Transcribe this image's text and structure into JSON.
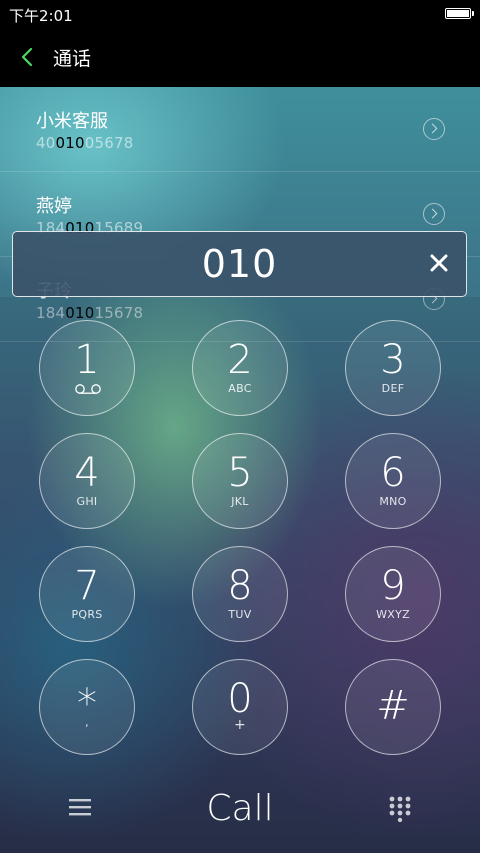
{
  "status_bar": {
    "time": "下午2:01"
  },
  "header": {
    "title": "通话"
  },
  "contacts": [
    {
      "name": "小米客服",
      "number_pre": "40",
      "number_match": "010",
      "number_post": "05678"
    },
    {
      "name": "燕婷",
      "number_pre": "184",
      "number_match": "010",
      "number_post": "15689"
    },
    {
      "name": "子玲",
      "number_pre": "184",
      "number_match": "010",
      "number_post": "15678"
    }
  ],
  "dial": {
    "number": "010"
  },
  "keypad": [
    {
      "digit": "1",
      "letters": ""
    },
    {
      "digit": "2",
      "letters": "ABC"
    },
    {
      "digit": "3",
      "letters": "DEF"
    },
    {
      "digit": "4",
      "letters": "GHI"
    },
    {
      "digit": "5",
      "letters": "JKL"
    },
    {
      "digit": "6",
      "letters": "MNO"
    },
    {
      "digit": "7",
      "letters": "PQRS"
    },
    {
      "digit": "8",
      "letters": "TUV"
    },
    {
      "digit": "9",
      "letters": "WXYZ"
    },
    {
      "digit": "*",
      "letters": ","
    },
    {
      "digit": "0",
      "letters": "+"
    },
    {
      "digit": "#",
      "letters": ""
    }
  ],
  "bottom_bar": {
    "call_label": "Call"
  },
  "icons": {
    "back": "chevron-left-icon",
    "info": "chevron-right-circle-icon",
    "clear": "close-icon",
    "voicemail": "voicemail-icon",
    "menu": "menu-icon",
    "dialpad": "dialpad-icon"
  },
  "colors": {
    "accent": "#4cd964"
  }
}
